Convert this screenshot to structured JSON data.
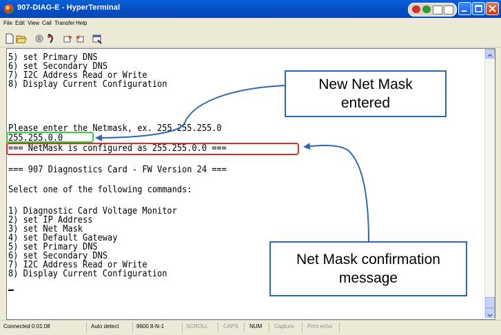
{
  "window": {
    "title": "907-DIAG-E - HyperTerminal",
    "accent": "#0451c6"
  },
  "menu": {
    "items": [
      "File",
      "Edit",
      "View",
      "Call",
      "Transfer",
      "Help"
    ]
  },
  "toolbar": {
    "buttons": [
      "new-icon",
      "open-icon",
      "disconnect-icon",
      "call-icon",
      "send-icon",
      "receive-icon",
      "properties-icon"
    ]
  },
  "terminal": {
    "lines": [
      "5) set Primary DNS",
      "6) set Secondary DNS",
      "7) I2C Address Read or Write",
      "8) Display Current Configuration",
      "",
      "Please enter the Netmask, ex. 255.255.255.0",
      "255.255.0.0",
      "=== NetMask is configured as 255.255.0.0 ===",
      "",
      "=== 907 Diagnostics Card - FW Version 24 ===",
      "",
      "Select one of the following commands:",
      "",
      "1) Diagnostic Card Voltage Monitor",
      "2) set IP Address",
      "3) set Net Mask",
      "4) set Default Gateway",
      "5) set Primary DNS",
      "6) set Secondary DNS",
      "7) I2C Address Read or Write",
      "8) Display Current Configuration"
    ]
  },
  "status": {
    "connected": "Connected 0:01:08",
    "detect": "Auto detect",
    "settings": "9600 8-N-1",
    "scroll": "SCROLL",
    "caps": "CAPS",
    "num": "NUM",
    "capture": "Capture",
    "print_echo": "Print echo"
  },
  "annotations": {
    "callout_1": "New Net Mask\nentered",
    "callout_2": "Net Mask confirmation\nmessage",
    "highlight_green": "#35d335",
    "highlight_red": "#e02a2a",
    "arrow_color": "#2c66b5"
  }
}
